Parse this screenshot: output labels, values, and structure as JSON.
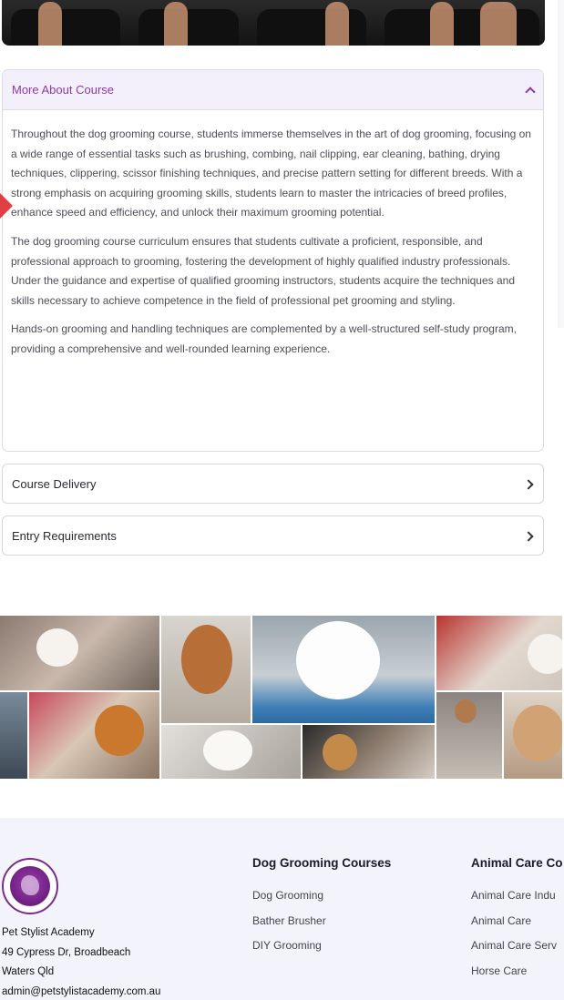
{
  "accordion": {
    "more_about": {
      "title": "More About Course",
      "paragraphs": [
        "Throughout the dog grooming course, students immerse themselves in the art of dog grooming, focusing on a wide range of essential tasks such as brushing, combing, nail clipping, ear cleaning, bathing, drying techniques, clippering, scissor finishing techniques, and precise pattern setting for different breeds. With a strong emphasis on acquiring grooming skills, students learn to master the intricacies of breed profiles, enhance speed and efficiency, and unlock their maximum grooming potential.",
        "The dog grooming course  curriculum ensures that students cultivate a proficient, responsible, and professional approach to grooming, fostering the development of highly qualified industry professionals. Under the guidance and expertise of qualified grooming instructors, students acquire the techniques and skills necessary to achieve competence in the field of professional pet grooming and styling.",
        "Hands-on grooming and handling techniques are complemented by a well-structured self-study program, providing a comprehensive and well-rounded learning experience."
      ]
    },
    "course_delivery": {
      "title": "Course Delivery"
    },
    "entry_requirements": {
      "title": "Entry Requirements"
    }
  },
  "footer": {
    "address": {
      "name": "Pet Stylist Academy",
      "street": "49 Cypress Dr, Broadbeach",
      "suburb": "Waters Qld",
      "email": "admin@petstylistacademy.com.au"
    },
    "col1": {
      "heading": "Dog Grooming Courses",
      "links": [
        "Dog Grooming",
        "Bather Brusher",
        "DIY Grooming"
      ]
    },
    "col2": {
      "heading": "Animal Care Co",
      "links": [
        "Animal Care Indu",
        "Animal Care",
        "Animal Care Serv",
        "Horse Care"
      ]
    }
  },
  "colors": {
    "accent_purple": "#8a3aa8",
    "footer_bg": "#f3f3fb"
  },
  "icons": [
    "chevron-up-icon",
    "chevron-right-icon",
    "academy-logo"
  ]
}
